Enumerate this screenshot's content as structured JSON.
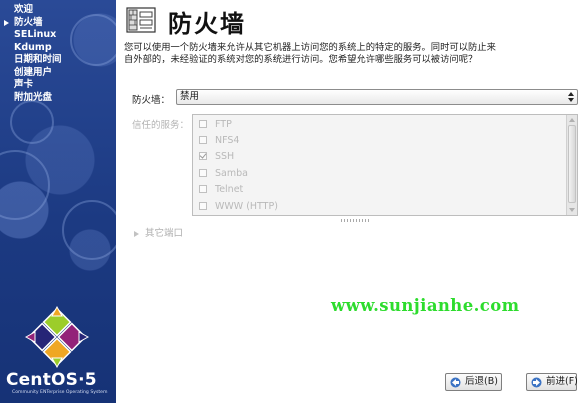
{
  "sidebar": {
    "steps": [
      {
        "label": "欢迎",
        "current": false
      },
      {
        "label": "防火墙",
        "current": true
      },
      {
        "label": "SELinux",
        "current": false
      },
      {
        "label": "Kdump",
        "current": false
      },
      {
        "label": "日期和时间",
        "current": false
      },
      {
        "label": "创建用户",
        "current": false
      },
      {
        "label": "声卡",
        "current": false
      },
      {
        "label": "附加光盘",
        "current": false
      }
    ],
    "brand": "CentOS·5",
    "tagline": "Community ENTerprise Operating System"
  },
  "page": {
    "title": "防火墙",
    "description": "您可以使用一个防火墙来允许从其它机器上访问您的系统上的特定的服务。同时可以防止来自外部的，未经验证的系统对您的系统进行访问。您希望允许哪些服务可以被访问呢？"
  },
  "firewall": {
    "label": "防火墙：",
    "value": "禁用"
  },
  "trusted": {
    "label": "信任的服务：",
    "services": [
      {
        "name": "FTP",
        "checked": false
      },
      {
        "name": "NFS4",
        "checked": false
      },
      {
        "name": "SSH",
        "checked": true
      },
      {
        "name": "Samba",
        "checked": false
      },
      {
        "name": "Telnet",
        "checked": false
      },
      {
        "name": "WWW (HTTP)",
        "checked": false
      }
    ]
  },
  "other_ports": {
    "label": "其它端口"
  },
  "watermark": "www.sunjianhe.com",
  "buttons": {
    "back": "后退(B)",
    "next": "前进(F)"
  },
  "colors": {
    "sidebar_bg": "#1f3d86",
    "watermark": "#2ddc2d",
    "disabled_text": "#b9b9b9"
  },
  "icons": {
    "header": "firewall-wall-icon",
    "back": "back-arrow-icon",
    "next": "next-arrow-icon",
    "logo": "centos-logo-icon"
  }
}
